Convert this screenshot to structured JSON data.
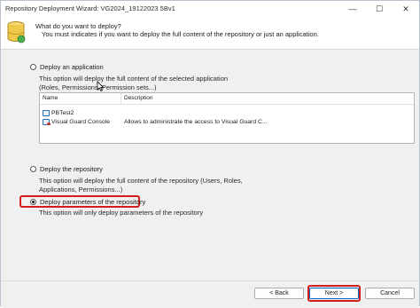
{
  "window": {
    "title": "Repository Deployment Wizard: VG2024_19122023 5Bv1",
    "controls": {
      "minimize": "—",
      "maximize": "☐",
      "close": "✕"
    }
  },
  "header": {
    "question": "What do you want to deploy?",
    "subtitle": "You must indicates if you want to deploy the full content of the repository or just an application.",
    "icon": "database-icon"
  },
  "options": [
    {
      "label": "Deploy an application",
      "selected": false,
      "description": "This option will deploy the full content of the selected application (Roles, Permissions, Permission sets...)"
    },
    {
      "label": "Deploy the repository",
      "selected": false,
      "description": "This option will deploy the full content of the repository (Users, Roles, Applications, Permissions...)"
    },
    {
      "label": "Deploy parameters of the repository",
      "selected": true,
      "description": "This option will only deploy parameters of the repository"
    }
  ],
  "applications_list": {
    "columns": [
      "Name",
      "Description"
    ],
    "rows": [
      {
        "name": "PBTest2",
        "description": ""
      },
      {
        "name": "Visual Guard Console",
        "description": "Allows to administrate the access to Visual Guard C..."
      }
    ]
  },
  "opt1_desc": {
    "line1": "This option will deploy the full content of the selected application",
    "line2": "(Roles, Permissions, Permission sets...)"
  },
  "opt2_desc": {
    "line1": "This option will deploy the full content of the repository (Users, Roles,",
    "line2": "Applications, Permissions...)"
  },
  "buttons": {
    "back": "< Back",
    "next": "Next >",
    "cancel": "Cancel"
  },
  "colors": {
    "highlight": "#d31d1d",
    "accent": "#0067c0",
    "panel_bg": "#f0f0f0"
  }
}
